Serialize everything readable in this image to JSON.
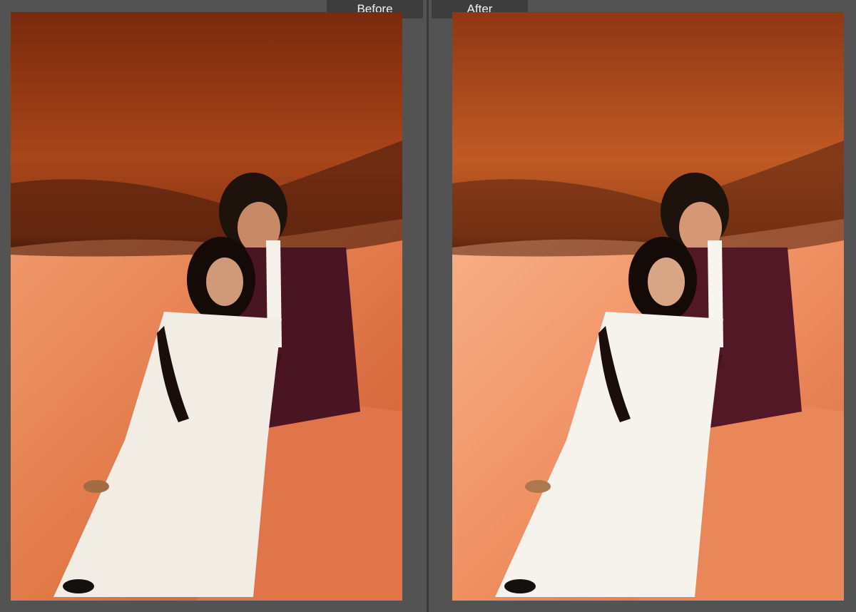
{
  "compare_view": {
    "before": {
      "label": "Before"
    },
    "after": {
      "label": "After"
    }
  },
  "colors": {
    "background": "#535353",
    "tab": "#3d3d3d",
    "tab_text": "#f2f2f2",
    "cave_rock_before": "#9a3a12",
    "cave_rock_after": "#b5501f",
    "sand_before": "#e87a4c",
    "sand_after": "#f29566",
    "suit": "#4a1522",
    "dress": "#f1ece4"
  },
  "icons": []
}
